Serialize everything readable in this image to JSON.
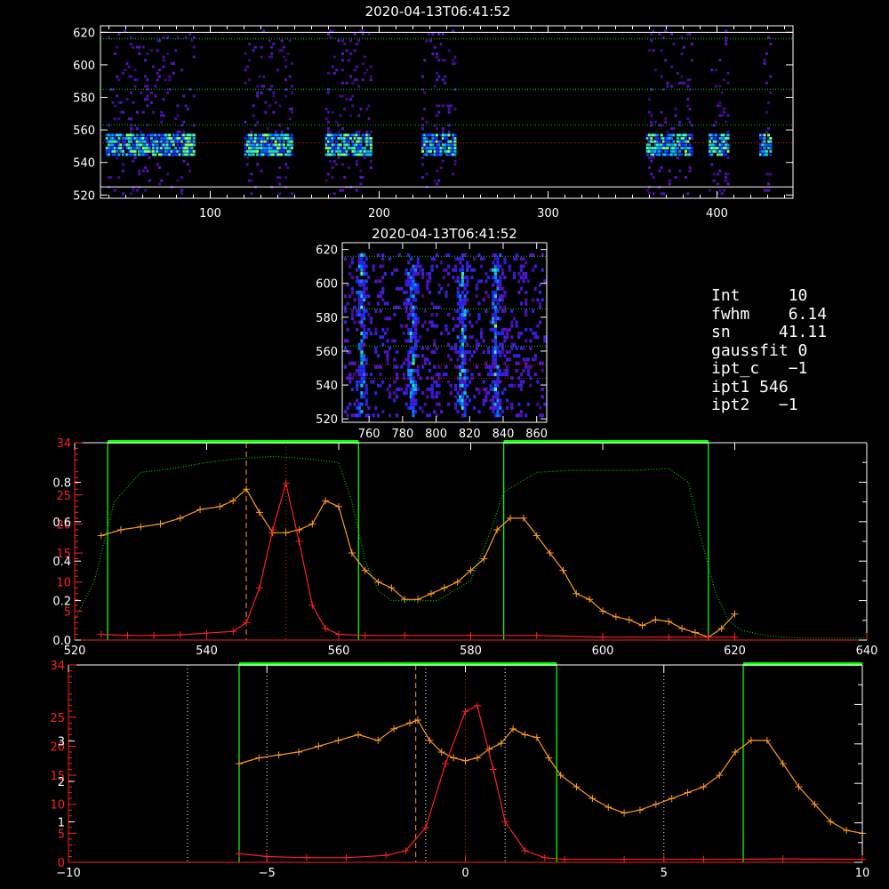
{
  "chart_data": [
    {
      "type": "heatmap",
      "title": "2020-04-13T06:41:52",
      "xlim": [
        35,
        445
      ],
      "ylim": [
        518,
        624
      ],
      "x_ticks": [
        "100",
        "200",
        "300",
        "400"
      ],
      "y_ticks": [
        "520",
        "540",
        "560",
        "580",
        "600",
        "620"
      ],
      "columns": [
        [
          38,
          90
        ],
        [
          120,
          148
        ],
        [
          168,
          195
        ],
        [
          225,
          245
        ],
        [
          358,
          385
        ],
        [
          395,
          406
        ],
        [
          425,
          432
        ]
      ],
      "bright_band": [
        544,
        556
      ],
      "hlines": [
        {
          "y": 616,
          "color": "#00cc00"
        },
        {
          "y": 585,
          "color": "#00cc00"
        },
        {
          "y": 563,
          "color": "#00cc00"
        },
        {
          "y": 552,
          "color": "#cc2200"
        },
        {
          "y": 525,
          "color": "#ffffff"
        },
        {
          "y": 620,
          "color": "#ffffff"
        }
      ]
    },
    {
      "type": "heatmap",
      "title": "2020-04-13T06:41:52",
      "xlim": [
        744,
        866
      ],
      "ylim": [
        518,
        624
      ],
      "x_ticks": [
        "760",
        "780",
        "800",
        "820",
        "840",
        "860"
      ],
      "y_ticks": [
        "520",
        "540",
        "560",
        "580",
        "600",
        "620"
      ],
      "streaks": [
        755,
        785,
        815,
        835
      ],
      "hlines": [
        {
          "y": 616,
          "color": "#00cc00"
        },
        {
          "y": 585,
          "color": "#00cc00"
        },
        {
          "y": 563,
          "color": "#00cc00"
        },
        {
          "y": 552,
          "color": "#cc2200"
        },
        {
          "y": 544,
          "color": "#cc2200"
        }
      ]
    },
    {
      "type": "line",
      "xlim": [
        520,
        640
      ],
      "x_ticks": [
        "520",
        "540",
        "560",
        "580",
        "600",
        "620",
        "640"
      ],
      "y_left_red_ticks": [
        "0",
        "5",
        "10",
        "15",
        "20",
        "25",
        "34"
      ],
      "y_left_white_ticks": [
        "0.0",
        "0.2",
        "0.4",
        "0.6",
        "0.8"
      ],
      "green_windows": [
        [
          525,
          563
        ],
        [
          585,
          616
        ]
      ],
      "vlines": [
        {
          "x": 546,
          "color": "#ff9a20",
          "style": "dashed"
        },
        {
          "x": 552,
          "color": "#cc2200",
          "style": "dotted"
        }
      ],
      "series": [
        {
          "color": "#ff9a20",
          "x": [
            524,
            527,
            530,
            533,
            536,
            539,
            542,
            544,
            546,
            548,
            550,
            552,
            554,
            556,
            558,
            560,
            562,
            564,
            566,
            568,
            570,
            572,
            574,
            576,
            578,
            580,
            582,
            584,
            586,
            588,
            590,
            592,
            594,
            596,
            598,
            600,
            602,
            604,
            606,
            608,
            610,
            612,
            614,
            616,
            618,
            620
          ],
          "y": [
            18,
            19,
            19.5,
            20,
            21,
            22.5,
            23,
            24,
            26,
            22,
            18.5,
            18.5,
            19,
            20,
            24,
            23,
            15,
            12,
            10,
            9,
            7,
            7,
            8,
            9,
            10,
            12,
            14,
            19,
            21,
            21,
            18,
            15,
            12,
            8,
            7,
            5,
            4,
            3.5,
            2.5,
            3.5,
            3.2,
            2,
            1.3,
            0.5,
            2,
            4.5
          ]
        },
        {
          "color": "#ff2020",
          "x": [
            524,
            528,
            532,
            536,
            540,
            544,
            546,
            548,
            550,
            552,
            554,
            556,
            558,
            560,
            564,
            570,
            580,
            590,
            600,
            610,
            616,
            620
          ],
          "y": [
            1,
            0.8,
            0.8,
            0.9,
            1.2,
            1.5,
            3,
            9,
            19,
            27,
            17,
            6,
            2,
            1,
            0.8,
            0.8,
            0.8,
            0.8,
            0.5,
            0.5,
            0.5,
            0.5
          ]
        },
        {
          "color": "#00cc00",
          "style": "dotted",
          "x": [
            520,
            523,
            526,
            530,
            535,
            540,
            545,
            550,
            555,
            560,
            562,
            564,
            566,
            568,
            570,
            575,
            580,
            583,
            585,
            590,
            595,
            600,
            605,
            610,
            613,
            615,
            617,
            619,
            621,
            625,
            630,
            640
          ],
          "y": [
            0.1,
            0.3,
            0.7,
            0.85,
            0.87,
            0.9,
            0.92,
            0.93,
            0.92,
            0.9,
            0.7,
            0.4,
            0.25,
            0.2,
            0.2,
            0.2,
            0.3,
            0.55,
            0.75,
            0.85,
            0.86,
            0.86,
            0.86,
            0.87,
            0.8,
            0.5,
            0.25,
            0.1,
            0.05,
            0.02,
            0.01,
            0.01
          ]
        }
      ]
    },
    {
      "type": "line",
      "xlim": [
        -10,
        10
      ],
      "x_ticks": [
        "−10",
        "−5",
        "0",
        "5",
        "10"
      ],
      "y_left_red_ticks": [
        "0",
        "5",
        "10",
        "15",
        "20",
        "25",
        "34"
      ],
      "y_left_white_ticks": [
        "1",
        "2",
        "3"
      ],
      "green_windows": [
        [
          -5.7,
          2.3
        ],
        [
          7,
          10.5
        ]
      ],
      "vlines": [
        {
          "x": -7,
          "color": "#ffffff",
          "style": "dotted"
        },
        {
          "x": -5,
          "color": "#ffffff",
          "style": "dotted"
        },
        {
          "x": -1,
          "color": "#ffffff",
          "style": "dotted"
        },
        {
          "x": 1,
          "color": "#ffffff",
          "style": "dotted"
        },
        {
          "x": 5,
          "color": "#ffffff",
          "style": "dotted"
        },
        {
          "x": 0,
          "color": "#cc2200",
          "style": "dotted"
        },
        {
          "x": -1.25,
          "color": "#ff9a20",
          "style": "dashed"
        }
      ],
      "series": [
        {
          "color": "#ff9a20",
          "x": [
            -5.7,
            -5.2,
            -4.7,
            -4.2,
            -3.7,
            -3.2,
            -2.7,
            -2.2,
            -1.8,
            -1.4,
            -1.2,
            -0.9,
            -0.6,
            -0.3,
            0,
            0.3,
            0.6,
            0.9,
            1.2,
            1.5,
            1.8,
            2.1,
            2.4,
            2.8,
            3.2,
            3.6,
            4.0,
            4.4,
            4.8,
            5.2,
            5.6,
            6.0,
            6.4,
            6.8,
            7.2,
            7.6,
            8.0,
            8.4,
            8.8,
            9.2,
            9.6,
            10
          ],
          "y": [
            17,
            18,
            18.5,
            19,
            20,
            21,
            22,
            21,
            23,
            24,
            24.5,
            21,
            19,
            18,
            17.5,
            18,
            19.5,
            20.5,
            23,
            22,
            21.5,
            18,
            15,
            13,
            11,
            9.5,
            8.5,
            9,
            10,
            11,
            12,
            13,
            15,
            19,
            21,
            21,
            17,
            13,
            10,
            7,
            5.5,
            5
          ]
        },
        {
          "color": "#ff2020",
          "x": [
            -5.7,
            -5,
            -4,
            -3,
            -2,
            -1.5,
            -1,
            -0.5,
            0,
            0.3,
            0.7,
            1,
            1.5,
            2,
            2.5,
            4,
            6,
            8,
            10
          ],
          "y": [
            1.5,
            1,
            0.8,
            0.8,
            1.2,
            2,
            6,
            17,
            26,
            27,
            16,
            7,
            2,
            0.8,
            0.5,
            0.5,
            0.5,
            0.6,
            0.5
          ]
        }
      ]
    }
  ],
  "info": {
    "l1": "Int     10",
    "l2": "fwhm    6.14",
    "l3": "sn     41.11",
    "l4": "gaussfit 0",
    "l5": "ipt_c   −1",
    "l6": "ipt1 546",
    "l7": "ipt2   −1"
  },
  "colors": {
    "axis": "#ffffff",
    "red": "#ff2020",
    "orange": "#ff9a20",
    "green": "#00ff00"
  }
}
